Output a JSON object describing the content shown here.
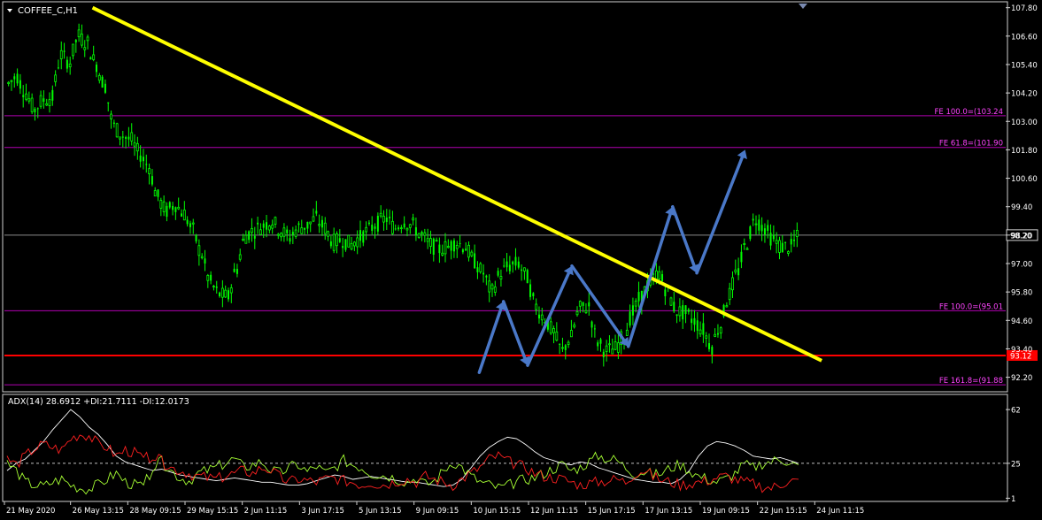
{
  "chart_data": [
    {
      "type": "candlestick",
      "title": "COFFEE_C,H1",
      "ylim": [
        91.7,
        107.9
      ],
      "y_ticks": [
        "107.80",
        "106.60",
        "105.40",
        "104.20",
        "103.00",
        "101.80",
        "100.60",
        "99.40",
        "98.20",
        "97.00",
        "95.80",
        "94.60",
        "93.40",
        "92.20"
      ],
      "x_ticks": [
        "21 May 2020",
        "26 May 13:15",
        "28 May 09:15",
        "29 May 15:15",
        "2 Jun 11:15",
        "3 Jun 17:15",
        "5 Jun 13:15",
        "9 Jun 09:15",
        "10 Jun 15:15",
        "12 Jun 11:15",
        "15 Jun 17:15",
        "17 Jun 13:15",
        "19 Jun 09:15",
        "22 Jun 15:15",
        "24 Jun 11:15"
      ],
      "close_series": [
        104.6,
        104.9,
        104.2,
        103.5,
        103.9,
        104.0,
        105.8,
        105.5,
        106.6,
        106.3,
        105.4,
        104.5,
        102.8,
        102.4,
        102.2,
        101.6,
        101.1,
        99.8,
        99.2,
        99.5,
        99.1,
        98.4,
        97.4,
        96.2,
        95.7,
        95.6,
        96.8,
        98.2,
        98.4,
        98.6,
        98.8,
        98.4,
        98.1,
        98.5,
        98.6,
        98.9,
        98.5,
        97.9,
        98.0,
        97.8,
        98.1,
        98.4,
        98.7,
        98.9,
        98.5,
        98.8,
        98.6,
        98.2,
        97.8,
        97.6,
        97.7,
        97.9,
        97.7,
        97.1,
        96.6,
        95.8,
        96.6,
        96.9,
        97.0,
        96.4,
        95.2,
        94.7,
        94.1,
        93.3,
        93.9,
        95.1,
        95.2,
        93.7,
        93.3,
        93.4,
        93.9,
        94.9,
        95.6,
        96.2,
        96.6,
        95.8,
        95.0,
        94.9,
        94.6,
        94.2,
        93.5,
        94.4,
        95.7,
        96.7,
        97.9,
        98.9,
        98.5,
        98.0,
        97.7,
        97.7,
        98.2
      ],
      "current_price": "98.20",
      "support_level": "93.12",
      "levels": [
        {
          "value": 103.24,
          "label": "FE 100.0=(103.24",
          "color": "#b000b0"
        },
        {
          "value": 101.9,
          "label": "FE 61.8=(101.90",
          "color": "#b000b0"
        },
        {
          "value": 95.01,
          "label": "FE 100.0=(95.01",
          "color": "#b000b0"
        },
        {
          "value": 91.88,
          "label": "FE 161.8=(91.88",
          "color": "#b000b0"
        }
      ],
      "trendline": {
        "start": {
          "index": 21,
          "price": 107.8
        },
        "end": {
          "index": 202,
          "price": 92.9
        },
        "color": "#ffff00"
      },
      "projection_path": [
        {
          "index": 117,
          "price": 92.4
        },
        {
          "index": 123,
          "price": 95.4
        },
        {
          "index": 129,
          "price": 92.7
        },
        {
          "index": 140,
          "price": 96.9
        },
        {
          "index": 154,
          "price": 93.5
        },
        {
          "index": 165,
          "price": 99.4
        },
        {
          "index": 171,
          "price": 96.6
        },
        {
          "index": 183,
          "price": 101.8
        }
      ],
      "colors": {
        "candle": "#00ff00",
        "arrow": "#4a78c8",
        "support": "#ff0000",
        "level": "#b000b0",
        "trendline": "#ffff00"
      }
    },
    {
      "type": "line",
      "title": "ADX(14) 28.6912 +DI:21.7111 -DI:12.0173",
      "ylim": [
        0,
        70
      ],
      "y_ticks": [
        "62",
        "25",
        "1"
      ],
      "reference_level": 25,
      "series": [
        {
          "name": "ADX",
          "color": "#ffffff",
          "values": [
            20,
            25,
            28,
            34,
            40,
            48,
            55,
            62,
            57,
            50,
            45,
            38,
            30,
            26,
            24,
            22,
            20,
            21,
            19,
            17,
            16,
            15,
            14,
            13,
            14,
            15,
            14,
            13,
            12,
            12,
            11,
            10,
            10,
            11,
            13,
            15,
            17,
            16,
            14,
            15,
            16,
            15,
            14,
            13,
            12,
            12,
            11,
            10,
            9,
            10,
            14,
            22,
            30,
            36,
            40,
            43,
            42,
            38,
            33,
            29,
            27,
            25,
            24,
            26,
            25,
            22,
            20,
            18,
            16,
            14,
            13,
            12,
            12,
            11,
            14,
            20,
            30,
            37,
            40,
            39,
            37,
            34,
            30,
            29,
            28,
            29,
            27,
            25
          ]
        },
        {
          "name": "+DI",
          "color": "#a6ff33",
          "values": [
            25,
            20,
            12,
            10,
            9,
            12,
            14,
            10,
            8,
            7,
            10,
            14,
            18,
            12,
            10,
            9,
            22,
            26,
            20,
            15,
            13,
            18,
            20,
            22,
            25,
            28,
            22,
            24,
            26,
            20,
            18,
            22,
            24,
            19,
            23,
            18,
            22,
            27,
            24,
            22,
            18,
            17,
            16,
            14,
            12,
            15,
            10,
            13,
            20,
            26,
            22,
            16,
            12,
            10,
            8,
            9,
            12,
            14,
            15,
            18,
            21,
            24,
            20,
            22,
            26,
            30,
            28,
            27,
            22,
            18,
            19,
            17,
            18,
            22,
            24,
            20,
            16,
            14,
            12,
            14,
            18,
            24,
            22,
            25,
            26,
            28,
            26,
            22
          ]
        },
        {
          "name": "-DI",
          "color": "#ff2020",
          "values": [
            28,
            24,
            30,
            35,
            38,
            36,
            34,
            42,
            45,
            44,
            38,
            36,
            30,
            34,
            32,
            28,
            30,
            26,
            22,
            20,
            18,
            16,
            15,
            14,
            16,
            18,
            20,
            18,
            22,
            20,
            15,
            12,
            14,
            13,
            12,
            14,
            15,
            13,
            12,
            10,
            12,
            10,
            11,
            13,
            14,
            12,
            16,
            14,
            12,
            10,
            14,
            18,
            22,
            28,
            30,
            26,
            24,
            22,
            18,
            16,
            15,
            14,
            12,
            10,
            11,
            12,
            13,
            14,
            12,
            18,
            20,
            16,
            13,
            12,
            10,
            11,
            12,
            13,
            15,
            16,
            14,
            12,
            11,
            9,
            8,
            10,
            14,
            12
          ]
        }
      ]
    }
  ]
}
